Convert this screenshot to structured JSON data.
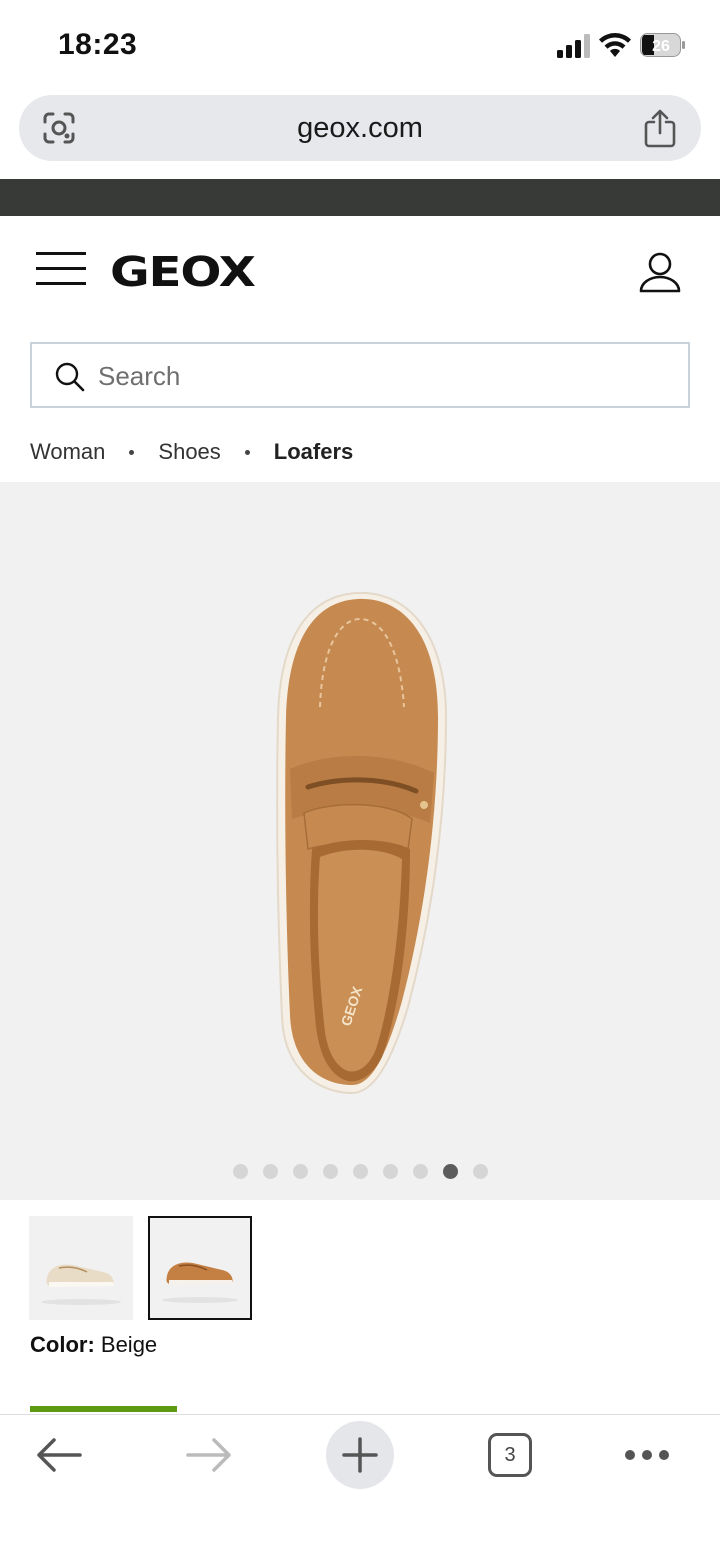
{
  "status_bar": {
    "time": "18:23",
    "battery": "26"
  },
  "browser": {
    "url": "geox.com",
    "tab_count": "3"
  },
  "header": {
    "logo": "GEOX"
  },
  "search": {
    "placeholder": "Search"
  },
  "breadcrumb": [
    "Woman",
    "Shoes",
    "Loafers"
  ],
  "gallery": {
    "image_count": 9,
    "active_index": 7
  },
  "product": {
    "color_label": "Color:",
    "color_value": "Beige"
  },
  "icons": {
    "status": [
      "signal-icon",
      "wifi-icon",
      "battery-icon"
    ],
    "browser": [
      "lens-icon",
      "share-icon"
    ],
    "header": [
      "menu-icon",
      "account-icon"
    ],
    "search": "search-icon",
    "toolbar": [
      "back-arrow-icon",
      "forward-arrow-icon",
      "plus-icon",
      "tabs-icon",
      "more-icon"
    ]
  },
  "colors": {
    "accent_green": "#5c9a12",
    "promo_strip": "#373a36",
    "url_bar": "#e6e8ec"
  }
}
